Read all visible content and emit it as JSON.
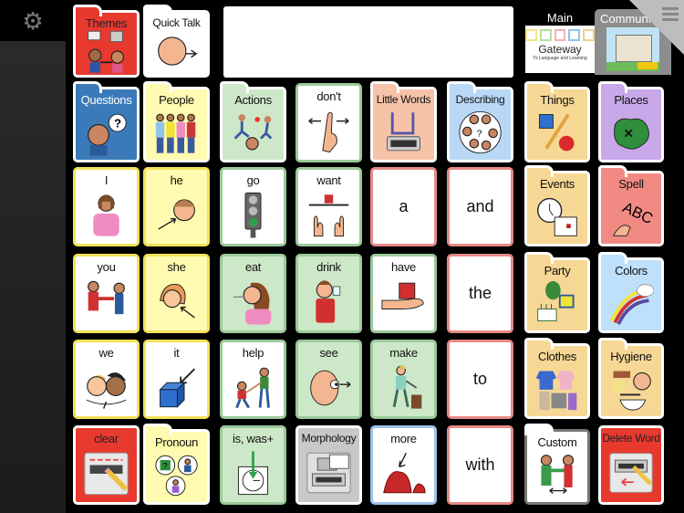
{
  "app": {
    "settings_icon": "gear-icon",
    "menu_icon": "hamburger-menu-icon",
    "message_window": ""
  },
  "tabs": {
    "main": {
      "label": "Main",
      "card_title": "Gateway",
      "card_subtitle": "To Language and Learning"
    },
    "community": {
      "label": "Community"
    }
  },
  "colors": {
    "red": "#e8392f",
    "white": "#ffffff",
    "blue": "#3a7ab8",
    "yellow": "#fffbb0",
    "green": "#cde8c8",
    "salmon": "#f6c3a8",
    "lightblue": "#b9d8f6",
    "tan": "#f7d795",
    "purple": "#c8a8e8",
    "pink": "#f28a84",
    "gray": "#c8c8c8",
    "skyblue": "#bfe0fa"
  },
  "grid": [
    {
      "label": "Themes",
      "type": "folder",
      "icon": "communication-icon",
      "color": "red",
      "col": 0,
      "row": 0
    },
    {
      "label": "Quick Talk",
      "type": "folder",
      "icon": "speaking-head-icon",
      "color": "white",
      "col": 1,
      "row": 0
    },
    {
      "label": "Questions",
      "type": "folder",
      "icon": "question-person-icon",
      "color": "blue",
      "col": 0,
      "row": 1
    },
    {
      "label": "People",
      "type": "folder",
      "icon": "people-icon",
      "color": "yellow",
      "col": 1,
      "row": 1
    },
    {
      "label": "Actions",
      "type": "folder",
      "icon": "actions-icon",
      "color": "green",
      "col": 2,
      "row": 1
    },
    {
      "label": "don't",
      "type": "word",
      "icon": "finger-no-icon",
      "color": "white",
      "border": "green",
      "col": 3,
      "row": 1
    },
    {
      "label": "Little Words",
      "type": "folder",
      "icon": "keyboard-icon",
      "color": "salmon",
      "col": 4,
      "row": 1
    },
    {
      "label": "Describing",
      "type": "folder",
      "icon": "faces-icon",
      "color": "lightblue",
      "col": 5,
      "row": 1
    },
    {
      "label": "Things",
      "type": "folder",
      "icon": "things-icon",
      "color": "tan",
      "col": 6,
      "row": 1
    },
    {
      "label": "Places",
      "type": "folder",
      "icon": "map-icon",
      "color": "purple",
      "col": 7,
      "row": 1
    },
    {
      "label": "I",
      "type": "word",
      "icon": "person-self-icon",
      "color": "white",
      "border": "yellow",
      "col": 0,
      "row": 2
    },
    {
      "label": "he",
      "type": "word",
      "icon": "boy-face-icon",
      "color": "yellow",
      "border": "yellow",
      "col": 1,
      "row": 2
    },
    {
      "label": "go",
      "type": "word",
      "icon": "traffic-light-icon",
      "color": "white",
      "border": "green",
      "col": 2,
      "row": 2
    },
    {
      "label": "want",
      "type": "word",
      "icon": "want-hands-icon",
      "color": "white",
      "border": "green",
      "col": 3,
      "row": 2
    },
    {
      "label": "a",
      "type": "word",
      "icon": "",
      "color": "white",
      "border": "pink",
      "col": 4,
      "row": 2
    },
    {
      "label": "and",
      "type": "word",
      "icon": "",
      "color": "white",
      "border": "pink",
      "col": 5,
      "row": 2
    },
    {
      "label": "Events",
      "type": "folder",
      "icon": "clock-calendar-icon",
      "color": "tan",
      "col": 6,
      "row": 2
    },
    {
      "label": "Spell",
      "type": "folder",
      "icon": "abc-icon",
      "color": "pink",
      "col": 7,
      "row": 2
    },
    {
      "label": "you",
      "type": "word",
      "icon": "pointing-people-icon",
      "color": "white",
      "border": "yellow",
      "col": 0,
      "row": 3
    },
    {
      "label": "she",
      "type": "word",
      "icon": "girl-face-icon",
      "color": "yellow",
      "border": "yellow",
      "col": 1,
      "row": 3
    },
    {
      "label": "eat",
      "type": "word",
      "icon": "eating-icon",
      "color": "green",
      "border": "green",
      "col": 2,
      "row": 3
    },
    {
      "label": "drink",
      "type": "word",
      "icon": "drinking-icon",
      "color": "green",
      "border": "green",
      "col": 3,
      "row": 3
    },
    {
      "label": "have",
      "type": "word",
      "icon": "hand-holding-icon",
      "color": "white",
      "border": "green",
      "col": 4,
      "row": 3
    },
    {
      "label": "the",
      "type": "word",
      "icon": "",
      "color": "white",
      "border": "pink",
      "col": 5,
      "row": 3
    },
    {
      "label": "Party",
      "type": "folder",
      "icon": "party-icon",
      "color": "tan",
      "col": 6,
      "row": 3
    },
    {
      "label": "Colors",
      "type": "folder",
      "icon": "rainbow-icon",
      "color": "skyblue",
      "col": 7,
      "row": 3
    },
    {
      "label": "we",
      "type": "word",
      "icon": "two-faces-icon",
      "color": "white",
      "border": "yellow",
      "col": 0,
      "row": 4
    },
    {
      "label": "it",
      "type": "word",
      "icon": "cube-icon",
      "color": "white",
      "border": "yellow",
      "col": 1,
      "row": 4
    },
    {
      "label": "help",
      "type": "word",
      "icon": "helping-icon",
      "color": "white",
      "border": "green",
      "col": 2,
      "row": 4
    },
    {
      "label": "see",
      "type": "word",
      "icon": "eye-face-icon",
      "color": "green",
      "border": "green",
      "col": 3,
      "row": 4
    },
    {
      "label": "make",
      "type": "word",
      "icon": "hammer-icon",
      "color": "green",
      "border": "green",
      "col": 4,
      "row": 4
    },
    {
      "label": "to",
      "type": "word",
      "icon": "",
      "color": "white",
      "border": "pink",
      "col": 5,
      "row": 4
    },
    {
      "label": "Clothes",
      "type": "folder",
      "icon": "clothes-icon",
      "color": "tan",
      "col": 6,
      "row": 4
    },
    {
      "label": "Hygiene",
      "type": "folder",
      "icon": "toothbrush-icon",
      "color": "tan",
      "col": 7,
      "row": 4
    },
    {
      "label": "clear",
      "type": "action",
      "icon": "eraser-key-icon",
      "color": "red",
      "col": 0,
      "row": 5
    },
    {
      "label": "Pronoun",
      "type": "folder",
      "icon": "pronoun-icon",
      "color": "yellow",
      "col": 1,
      "row": 5
    },
    {
      "label": "is, was+",
      "type": "word",
      "icon": "clock-arrow-icon",
      "color": "green",
      "border": "green",
      "col": 2,
      "row": 5
    },
    {
      "label": "Morphology",
      "type": "action",
      "icon": "morphology-key-icon",
      "color": "gray",
      "col": 3,
      "row": 5
    },
    {
      "label": "more",
      "type": "word",
      "icon": "more-pile-icon",
      "color": "white",
      "border": "lightblue",
      "col": 4,
      "row": 5
    },
    {
      "label": "with",
      "type": "word",
      "icon": "",
      "color": "white",
      "border": "pink",
      "col": 5,
      "row": 5
    },
    {
      "label": "Custom",
      "type": "folder",
      "icon": "exchange-icon",
      "color": "white",
      "border": "gray",
      "col": 6,
      "row": 5
    },
    {
      "label": "Delete Word",
      "type": "action",
      "icon": "delete-key-icon",
      "color": "red",
      "col": 7,
      "row": 5
    }
  ]
}
